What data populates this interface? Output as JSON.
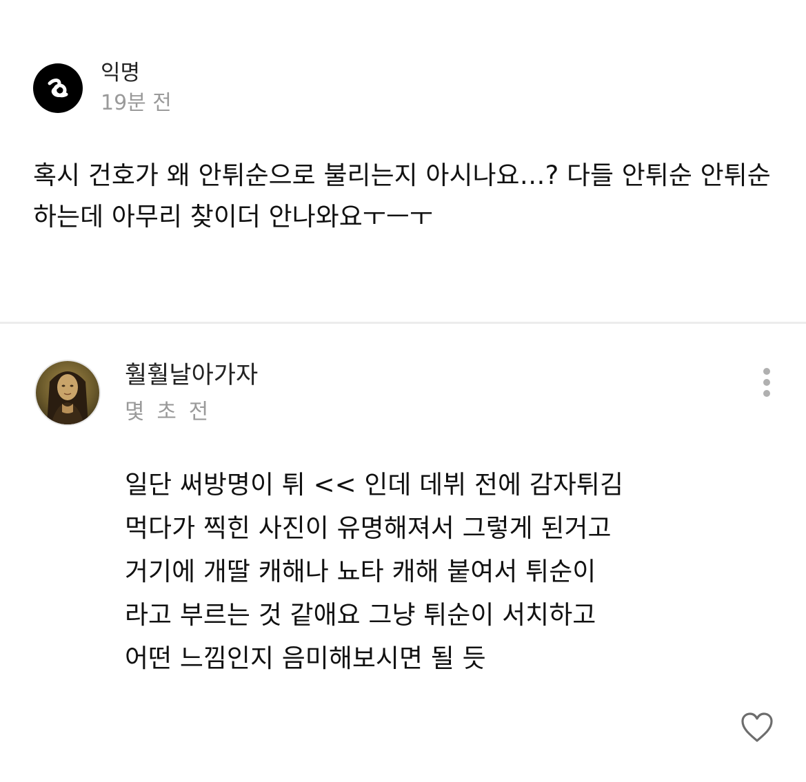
{
  "post": {
    "author": "익명",
    "time": "19분 전",
    "avatar_icon": "anonymous-logo-icon",
    "text": "혹시 건호가 왜 안튀순으로 불리는지 아시나요…? 다들 안튀순 안튀순하는데 아무리 찾이더 안나와요ㅜㅡㅜ"
  },
  "comment": {
    "author": "훨훨날아가자",
    "time": "몇 초 전",
    "avatar_icon": "portrait-avatar-icon",
    "lines": [
      "일단 써방명이 튀 << 인데 데뷔 전에 감자튀김",
      "먹다가 찍힌 사진이 유명해져서 그렇게 된거고",
      "거기에 개딸 캐해나 뇨타 캐해 붙여서 튀순이",
      "라고 부르는 것 같애요 그냥 튀순이 서치하고",
      "어떤 느낌인지 음미해보시면 될 듯"
    ],
    "more_icon": "more-vertical-icon",
    "like_icon": "heart-outline-icon"
  },
  "colors": {
    "text": "#111111",
    "muted": "#9a9a9a",
    "divider": "#ececec",
    "avatar_bg": "#000000"
  }
}
